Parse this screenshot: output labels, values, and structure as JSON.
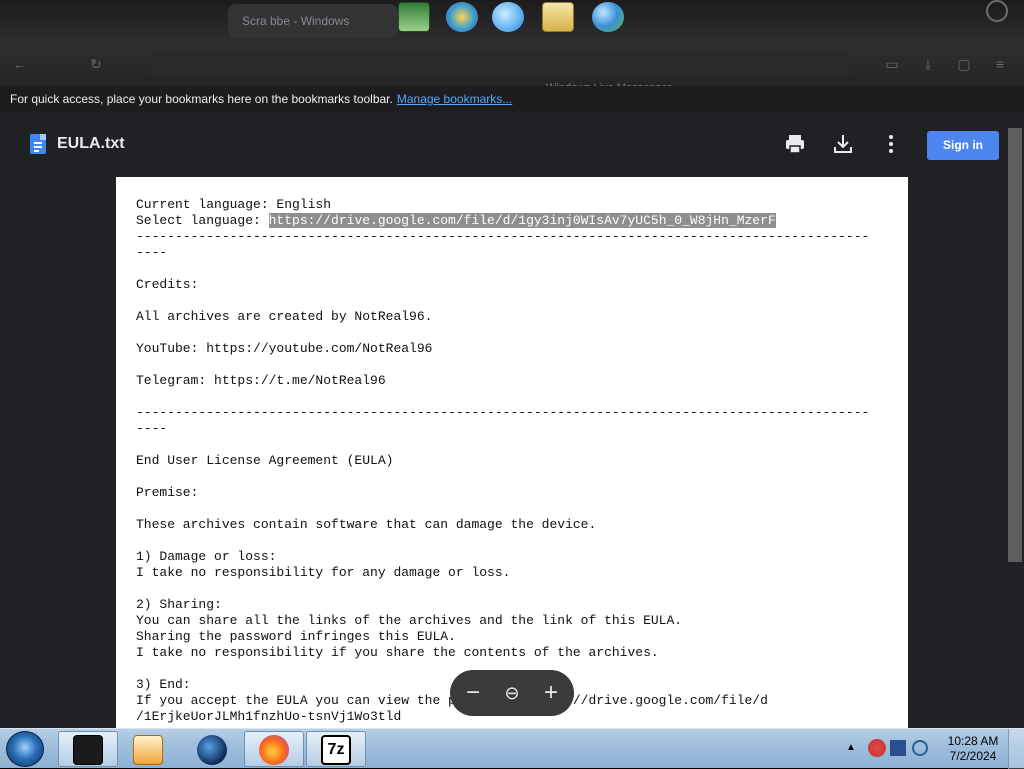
{
  "browser": {
    "tab_title": "Scra bbe - Windows",
    "bookmarks_bar": {
      "message": "For quick access, place your bookmarks here on the bookmarks toolbar.",
      "link_label": "Manage bookmarks..."
    }
  },
  "dock": {
    "label": "Windows Live Messenger",
    "icons": [
      "excel-icon",
      "windows-live-icon",
      "internet-explorer-icon",
      "photo-viewer-icon",
      "messenger-icon"
    ]
  },
  "viewer": {
    "file_name": "EULA.txt",
    "print_label": "Print",
    "download_label": "Download",
    "more_label": "More actions",
    "signin_label": "Sign in",
    "doc": {
      "line_01_prefix": "Current language: English",
      "line_02_prefix": "Select language: ",
      "line_02_link": "https://drive.google.com/file/d/1gy3inj0WIsAv7yUC5h_0_W8jHn_MzerF",
      "separator_a": "----------------------------------------------------------------------------------------------",
      "separator_b": "----",
      "credits_heading": "Credits:",
      "credits_line": "All archives are created by NotReal96.",
      "youtube_line": "YouTube: https://youtube.com/NotReal96",
      "telegram_line": "Telegram: https://t.me/NotReal96",
      "eula_heading": "End User License Agreement (EULA)",
      "premise_heading": "Premise:",
      "premise_line": "These archives contain software that can damage the device.",
      "s1_heading": "1) Damage or loss:",
      "s1_line": "I take no responsibility for any damage or loss.",
      "s2_heading": "2) Sharing:",
      "s2_line1": "You can share all the links of the archives and the link of this EULA.",
      "s2_line2": "Sharing the password infringes this EULA.",
      "s2_line3": "I take no responsibility if you share the contents of the archives.",
      "s3_heading": "3) End:",
      "s3_line1": "If you accept the EULA you can view the password: https://drive.google.com/file/d",
      "s3_line2": "/1ErjkeUorJLMh1fnzhUo-tsnVj1Wo3tld"
    },
    "zoom": {
      "zoom_out": "−",
      "zoom_reset": "⊖",
      "zoom_in": "+"
    }
  },
  "taskbar": {
    "clock_time": "10:28 AM",
    "clock_date": "7/2/2024",
    "items": [
      "command-window-icon",
      "media-player-icon",
      "globe-icon",
      "firefox-icon",
      "7zip-icon"
    ],
    "sevenzip_label": "7z"
  },
  "colors": {
    "signin_blue": "#4e86f0",
    "link_blue": "#59a6ff",
    "drive_blue": "#4285f4",
    "viewer_bg": "#202124"
  }
}
